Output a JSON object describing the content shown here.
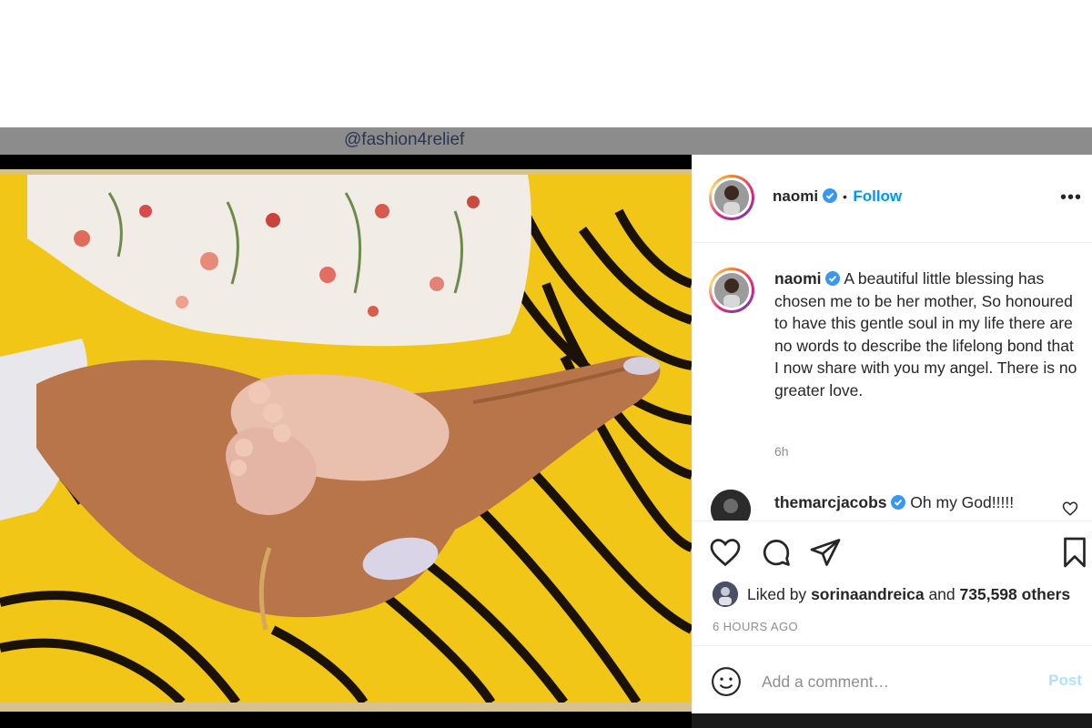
{
  "watermark": {
    "handle": "@fashion4relief"
  },
  "post": {
    "author": "naomi",
    "follow_label": "Follow",
    "more_glyph": "•••",
    "bullet": "•",
    "caption": "A beautiful little blessing has chosen me to be her mother, So honoured to have this gentle soul in my life there are no words to describe the lifelong bond that I now share with you my angel. There is no greater love.",
    "caption_age": "6h",
    "comments": [
      {
        "user": "themarcjacobs",
        "text": "Oh my God!!!!!"
      }
    ],
    "likes": {
      "prefix": "Liked by",
      "user": "sorinaandreica",
      "joiner": "and",
      "others": "735,598 others"
    },
    "timestamp": "6 HOURS AGO",
    "add_comment": {
      "placeholder": "Add a comment…",
      "post_label": "Post"
    }
  },
  "icons": {
    "verified": "verified-badge-icon",
    "like": "heart-icon",
    "comment": "comment-icon",
    "share": "paper-plane-icon",
    "save": "bookmark-icon",
    "emoji": "smiley-icon",
    "more": "more-options-icon"
  },
  "colors": {
    "accent": "#0095f6",
    "post_disabled": "#b2dffc",
    "verified": "#3897f0",
    "text": "#262626",
    "muted": "#8e8e8e",
    "watermark_bar": "#8c8c8c"
  }
}
